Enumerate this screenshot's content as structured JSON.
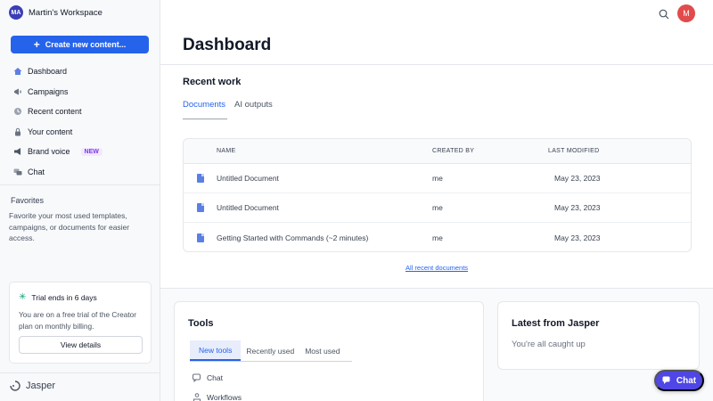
{
  "workspace": {
    "initials": "MA",
    "name": "Martin's Workspace"
  },
  "create_button": {
    "label": "Create new content..."
  },
  "nav": {
    "items": [
      {
        "label": "Dashboard",
        "icon": "home-icon"
      },
      {
        "label": "Campaigns",
        "icon": "campaign-icon"
      },
      {
        "label": "Recent content",
        "icon": "clock-icon"
      },
      {
        "label": "Your content",
        "icon": "lock-icon"
      },
      {
        "label": "Brand voice",
        "icon": "megaphone-icon",
        "badge": "NEW"
      },
      {
        "label": "Chat",
        "icon": "chat-icon"
      }
    ]
  },
  "favorites": {
    "title": "Favorites",
    "description": "Favorite your most used templates, campaigns, or documents for easier access."
  },
  "trial": {
    "title": "Trial ends in 6 days",
    "description": "You are on a free trial of the Creator plan on monthly billing.",
    "button": "View details"
  },
  "brand": {
    "name": "Jasper"
  },
  "user": {
    "initial": "M"
  },
  "page": {
    "title": "Dashboard"
  },
  "recent": {
    "title": "Recent work",
    "tabs": [
      "Documents",
      "AI outputs"
    ],
    "columns": {
      "name": "NAME",
      "created_by": "CREATED BY",
      "modified": "LAST MODIFIED"
    },
    "rows": [
      {
        "name": "Untitled Document",
        "created_by": "me",
        "modified": "May 23, 2023"
      },
      {
        "name": "Untitled Document",
        "created_by": "me",
        "modified": "May 23, 2023"
      },
      {
        "name": "Getting Started with Commands (~2 minutes)",
        "created_by": "me",
        "modified": "May 23, 2023"
      }
    ],
    "all_link": "All recent documents"
  },
  "tools": {
    "title": "Tools",
    "tabs": [
      "New tools",
      "Recently used",
      "Most used"
    ],
    "items": [
      "Chat",
      "Workflows"
    ]
  },
  "latest": {
    "title": "Latest from Jasper",
    "description": "You're all caught up"
  },
  "chat_fab": {
    "label": "Chat"
  },
  "colors": {
    "accent": "#2563eb",
    "chat_button": "#4f46e5",
    "avatar": "#e14b4b",
    "trial_icon": "#0f9d76"
  }
}
